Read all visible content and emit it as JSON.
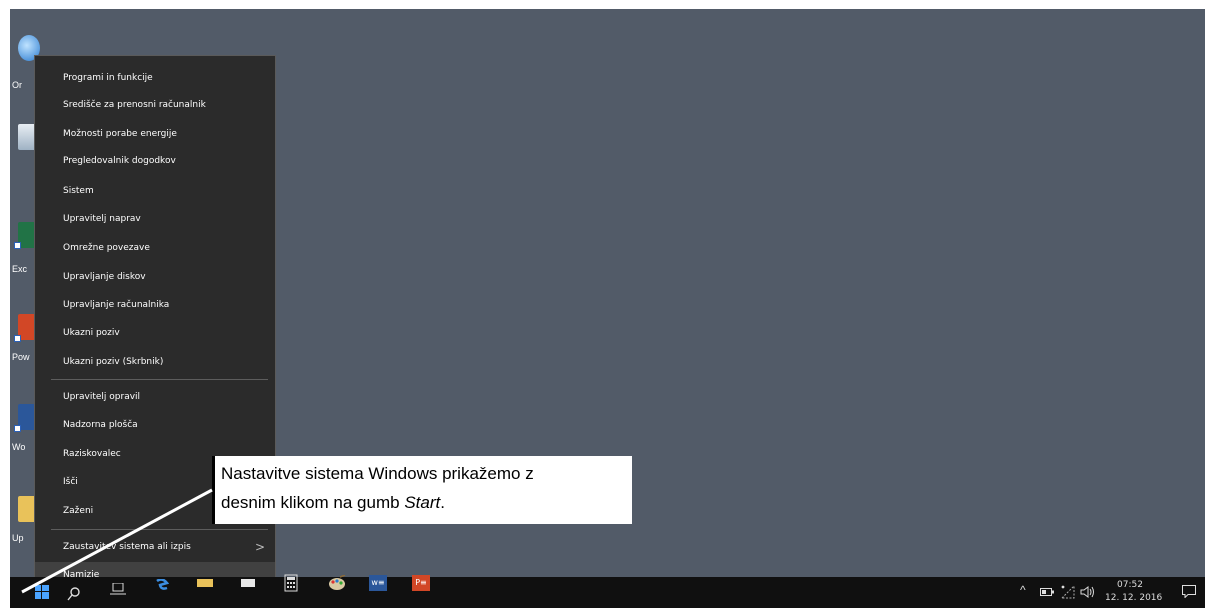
{
  "desktop": {
    "icons": [
      {
        "label": "Or",
        "icon": "globe-icon"
      },
      {
        "label": "",
        "icon": "recycle-bin-icon"
      },
      {
        "label": "Exc",
        "icon": "excel-shortcut-icon"
      },
      {
        "label": "Pow",
        "icon": "powerpoint-shortcut-icon"
      },
      {
        "label": "Wo",
        "icon": "word-shortcut-icon"
      },
      {
        "label": "Up",
        "icon": "folder-icon"
      }
    ]
  },
  "menu": {
    "group1": [
      "Programi in funkcije",
      "Središče za prenosni računalnik",
      "Možnosti porabe energije",
      "Pregledovalnik dogodkov",
      "Sistem",
      "Upravitelj naprav",
      "Omrežne povezave",
      "Upravljanje diskov",
      "Upravljanje računalnika",
      "Ukazni poziv",
      "Ukazni poziv (Skrbnik)"
    ],
    "group2": [
      "Upravitelj opravil",
      "Nadzorna plošča",
      "Raziskovalec",
      "Išči",
      "Zaženi"
    ],
    "group3": [
      "Zaustavitev sistema ali izpis",
      "Namizje"
    ],
    "submenu_chevron": ">"
  },
  "callout": {
    "line1": "Nastavitve sistema Windows prikažemo z",
    "line2_prefix": "desnim klikom na gumb ",
    "line2_emph": "Start",
    "line2_suffix": "."
  },
  "taskbar": {
    "apps": [
      "start-icon",
      "search-icon",
      "task-view-icon",
      "edge-icon",
      "file-explorer-icon",
      "store-icon",
      "calculator-icon",
      "paint-icon",
      "word-icon",
      "powerpoint-icon"
    ],
    "tray": {
      "chevron": "^",
      "time": "07:52",
      "date": "12. 12. 2016"
    }
  },
  "colors": {
    "desktop": "#525b68",
    "menu_bg": "#2b2b2b",
    "taskbar": "#101010",
    "word": "#2b579a",
    "powerpoint": "#d24726",
    "excel": "#217346"
  }
}
